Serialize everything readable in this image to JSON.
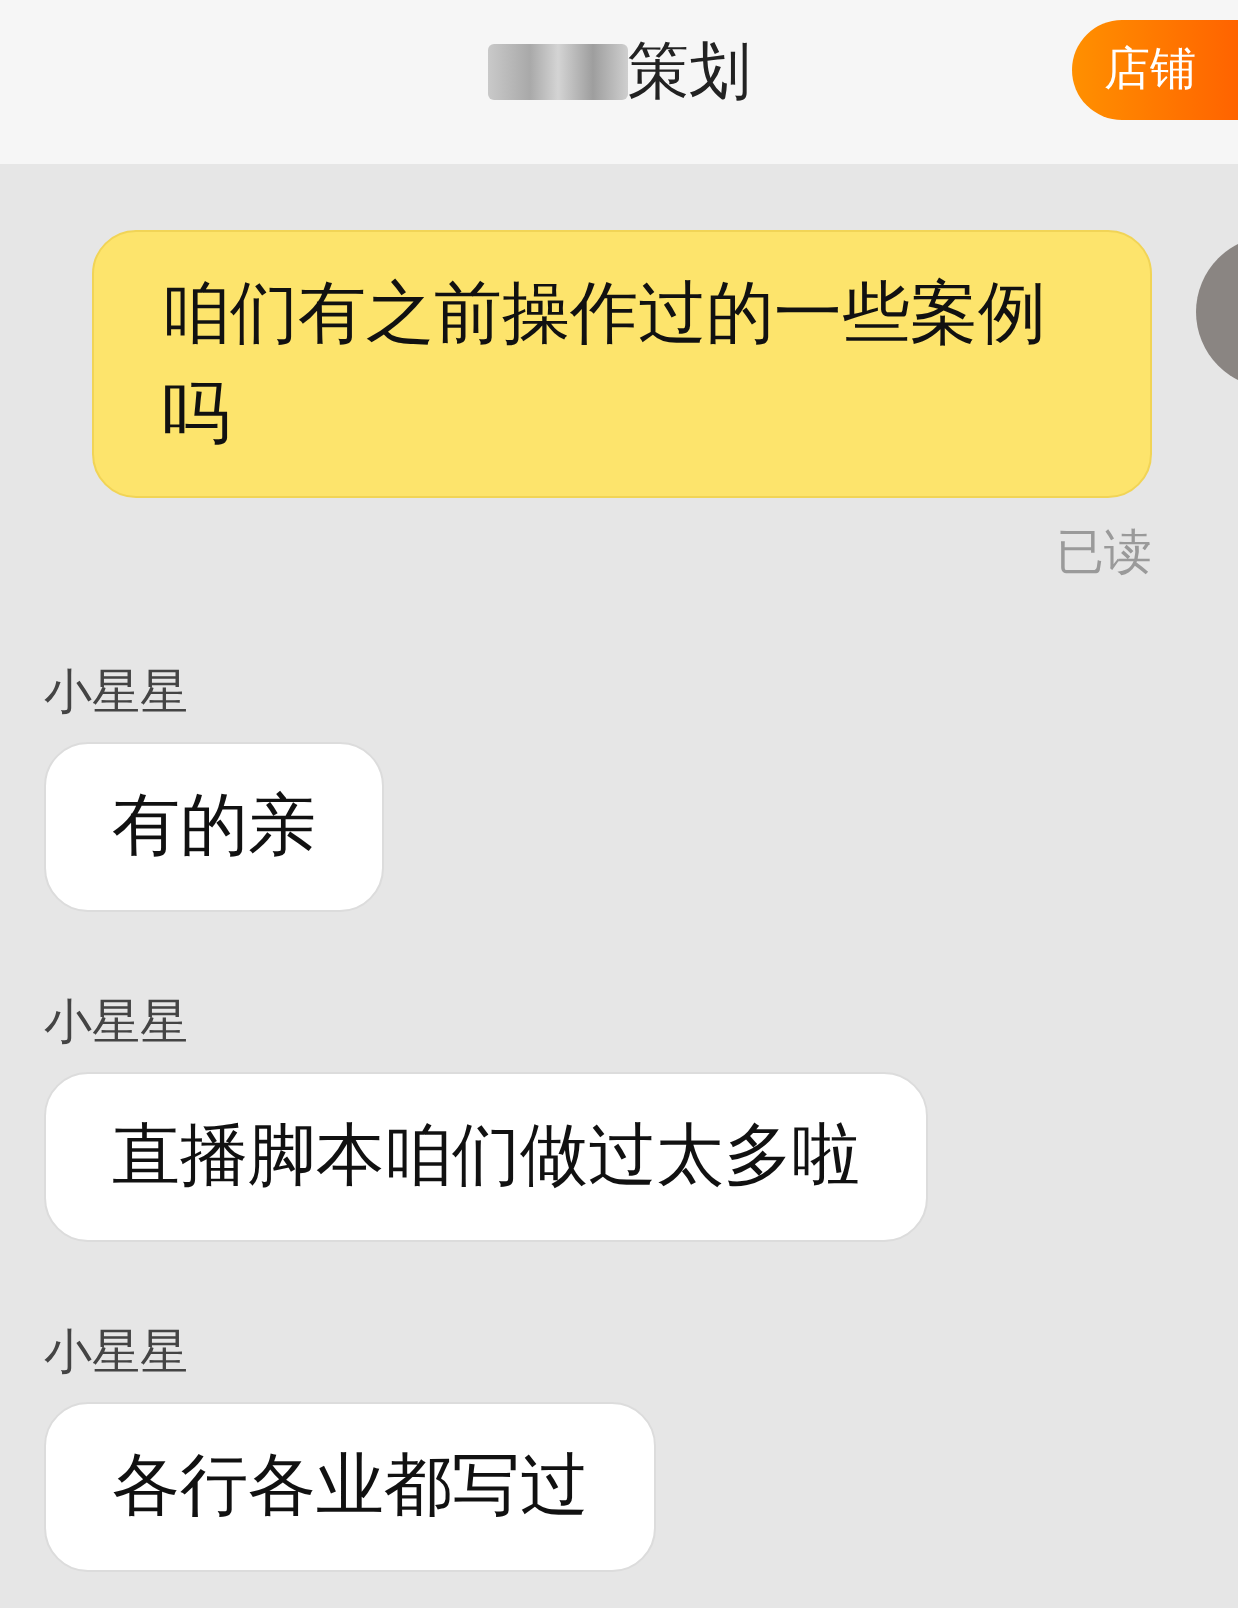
{
  "header": {
    "title": "策划",
    "store_button": "店铺"
  },
  "messages": [
    {
      "kind": "outgoing",
      "text": "咱们有之前操作过的一些案例吗",
      "status": "已读"
    },
    {
      "kind": "incoming",
      "sender": "小星星",
      "text": "有的亲"
    },
    {
      "kind": "incoming",
      "sender": "小星星",
      "text": "直播脚本咱们做过太多啦"
    },
    {
      "kind": "incoming",
      "sender": "小星星",
      "text": "各行各业都写过"
    }
  ]
}
